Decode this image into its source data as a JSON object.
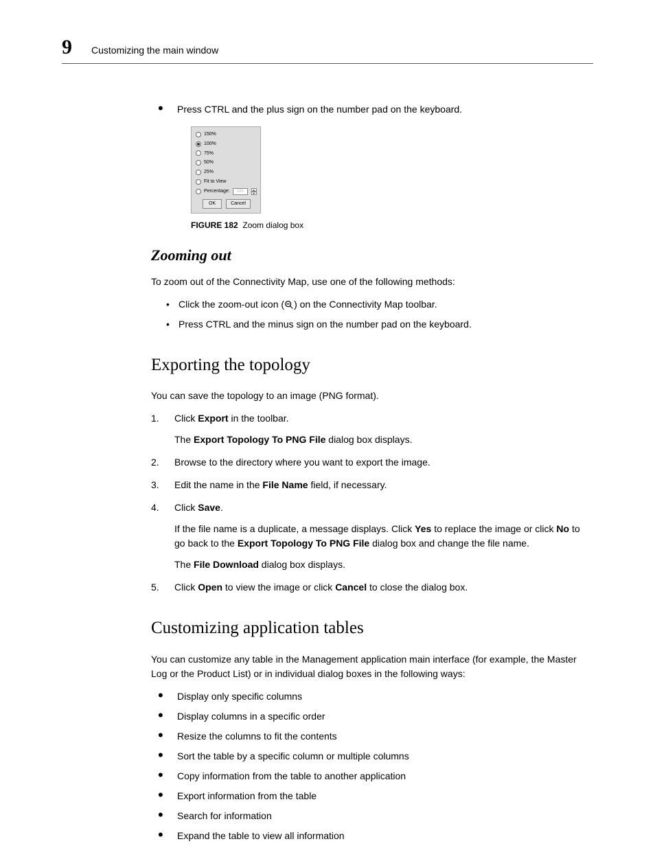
{
  "header": {
    "chapter_number": "9",
    "chapter_title": "Customizing the main window"
  },
  "intro_bullet": "Press CTRL and the plus sign on the number pad on the keyboard.",
  "zoom_dialog": {
    "options": [
      "150%",
      "100%",
      "75%",
      "50%",
      "25%",
      "Fit to View"
    ],
    "selected_index": 1,
    "percentage_label": "Percentage:",
    "percentage_value": "100",
    "ok": "OK",
    "cancel": "Cancel"
  },
  "figure": {
    "label": "FIGURE 182",
    "caption": "Zoom dialog box"
  },
  "zoom_out": {
    "heading": "Zooming out",
    "intro": "To zoom out of the Connectivity Map, use one of the following methods:",
    "bullet1_pre": "Click the zoom-out icon (",
    "bullet1_post": ") on the Connectivity Map toolbar.",
    "bullet2": "Press CTRL and the minus sign on the number pad on the keyboard."
  },
  "export": {
    "heading": "Exporting the topology",
    "intro": "You can save the topology to an image (PNG format).",
    "step1_pre": "Click ",
    "step1_bold": "Export",
    "step1_post": " in the toolbar.",
    "step1_sub_pre": "The ",
    "step1_sub_bold": "Export Topology To PNG File",
    "step1_sub_post": " dialog box displays.",
    "step2": "Browse to the directory where you want to export the image.",
    "step3_pre": "Edit the name in the ",
    "step3_bold": "File Name",
    "step3_post": " field, if necessary.",
    "step4_pre": "Click ",
    "step4_bold": "Save",
    "step4_post": ".",
    "step4_sub1_pre": "If the file name is a duplicate, a message displays. Click ",
    "step4_sub1_bold1": "Yes",
    "step4_sub1_mid": " to replace the image or click ",
    "step4_sub1_bold2": "No",
    "step4_sub1_post": " to go back to the ",
    "step4_sub1_bold3": "Export Topology To PNG File",
    "step4_sub1_end": " dialog box and change the file name.",
    "step4_sub2_pre": "The ",
    "step4_sub2_bold": "File Download",
    "step4_sub2_post": " dialog box displays.",
    "step5_pre": "Click ",
    "step5_bold1": "Open",
    "step5_mid": " to view the image or click ",
    "step5_bold2": "Cancel",
    "step5_post": " to close the dialog box."
  },
  "tables": {
    "heading": "Customizing application tables",
    "intro": "You can customize any table in the Management application main interface (for example, the Master Log or the Product List) or in individual dialog boxes in the following ways:",
    "bullets": [
      "Display only specific columns",
      "Display columns in a specific order",
      "Resize the columns to fit the contents",
      "Sort the table by a specific column or multiple columns",
      "Copy information from the table to another application",
      "Export information from the table",
      "Search for information",
      "Expand the table to view all information"
    ]
  }
}
